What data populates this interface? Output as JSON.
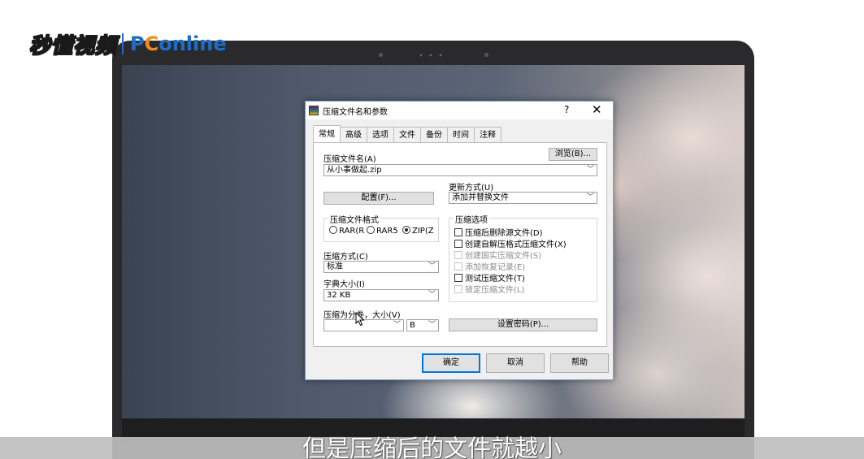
{
  "watermark": {
    "cn": "秒懂视频",
    "en_prefix": "P",
    "en_o": "C",
    "en_suffix": "online"
  },
  "subtitle": "但是压缩后的文件就越小",
  "dialog": {
    "title": "压缩文件名和参数",
    "help": "?",
    "close": "✕",
    "tabs": [
      "常规",
      "高级",
      "选项",
      "文件",
      "备份",
      "时间",
      "注释"
    ],
    "archive_name_label": "压缩文件名(A)",
    "browse_button": "浏览(B)...",
    "archive_name_value": "从小事做起.zip",
    "update_mode_label": "更新方式(U)",
    "update_mode_value": "添加并替换文件",
    "profile_button": "配置(F)...",
    "format_group": {
      "title": "压缩文件格式",
      "options": [
        "RAR(R",
        "RAR5",
        "ZIP(Z"
      ],
      "selected": "ZIP(Z"
    },
    "options_group": {
      "title": "压缩选项",
      "items": [
        {
          "label": "压缩后删除源文件(D)",
          "enabled": true
        },
        {
          "label": "创建自解压格式压缩文件(X)",
          "enabled": true
        },
        {
          "label": "创建固实压缩文件(S)",
          "enabled": false
        },
        {
          "label": "添加恢复记录(E)",
          "enabled": false
        },
        {
          "label": "测试压缩文件(T)",
          "enabled": true
        },
        {
          "label": "锁定压缩文件(L)",
          "enabled": false
        }
      ]
    },
    "method_label": "压缩方式(C)",
    "method_value": "标准",
    "dict_label": "字典大小(I)",
    "dict_value": "32 KB",
    "split_label": "压缩为分卷，大小(V)",
    "split_value": "",
    "split_unit": "B",
    "password_button": "设置密码(P)...",
    "ok_button": "确定",
    "cancel_button": "取消",
    "help_button": "帮助"
  }
}
